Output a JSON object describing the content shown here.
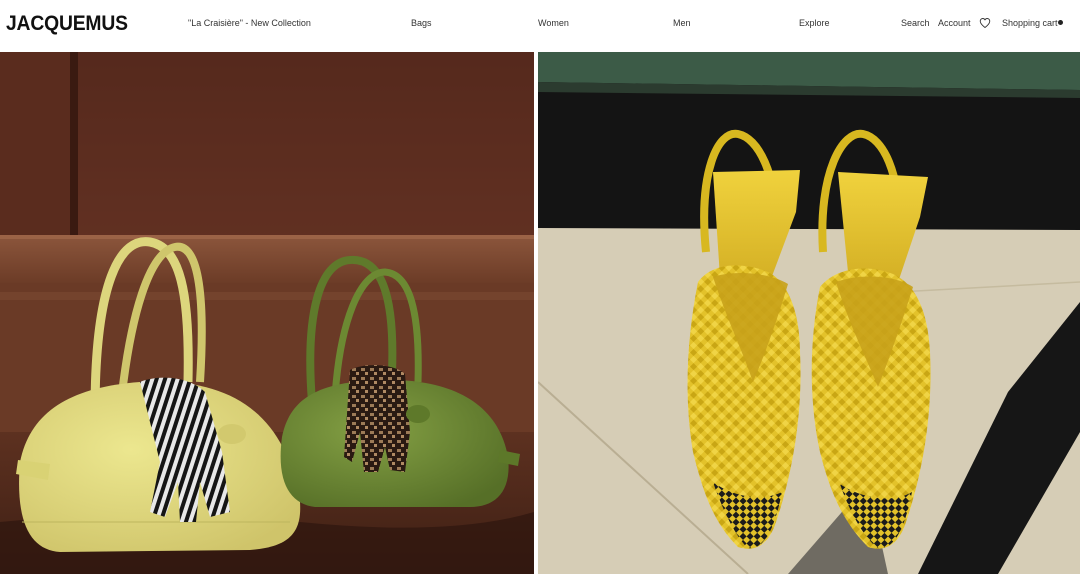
{
  "header": {
    "logo": "JACQUEMUS",
    "nav": {
      "collection": "\"La Craisière\" - New Collection",
      "bags": "Bags",
      "women": "Women",
      "men": "Men",
      "explore": "Explore"
    },
    "utility": {
      "search": "Search",
      "account": "Account",
      "wishlist_icon": "heart-icon",
      "cart": "Shopping cart"
    }
  },
  "colors": {
    "background": "#ffffff",
    "text": "#333333",
    "wood": "#6b3a28",
    "yellow_bag": "#e2dc86",
    "green_bag": "#6f8a36",
    "shoe_yellow": "#e5c62c"
  }
}
